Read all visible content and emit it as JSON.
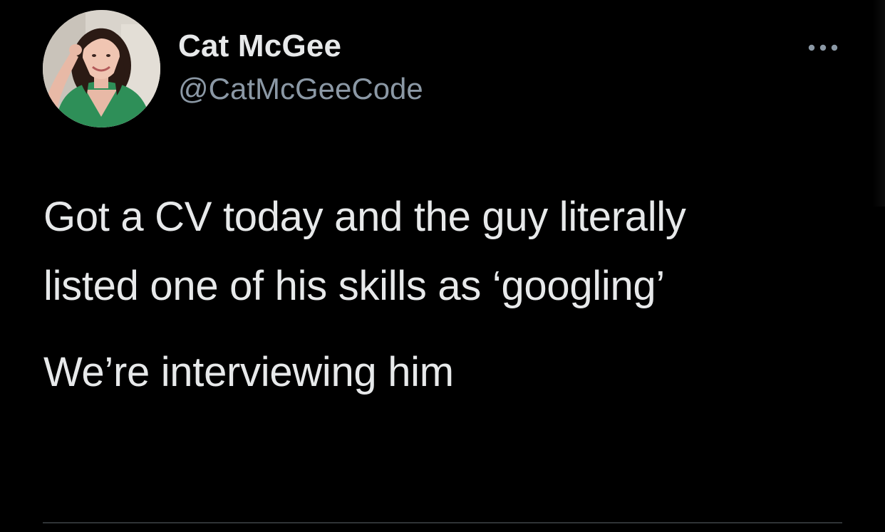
{
  "tweet": {
    "author": {
      "display_name": "Cat McGee",
      "handle": "@CatMcGeeCode",
      "avatar_icon": "profile-photo"
    },
    "body": {
      "line1": "Got a CV today and the guy literally",
      "line2": "listed one of his skills as ‘googling’",
      "line3": "We’re interviewing him"
    },
    "more_icon": "ellipsis-icon"
  },
  "colors": {
    "background": "#000000",
    "primary_text": "#e7e9ea",
    "secondary_text": "#8b98a5",
    "divider": "#2f3336"
  }
}
